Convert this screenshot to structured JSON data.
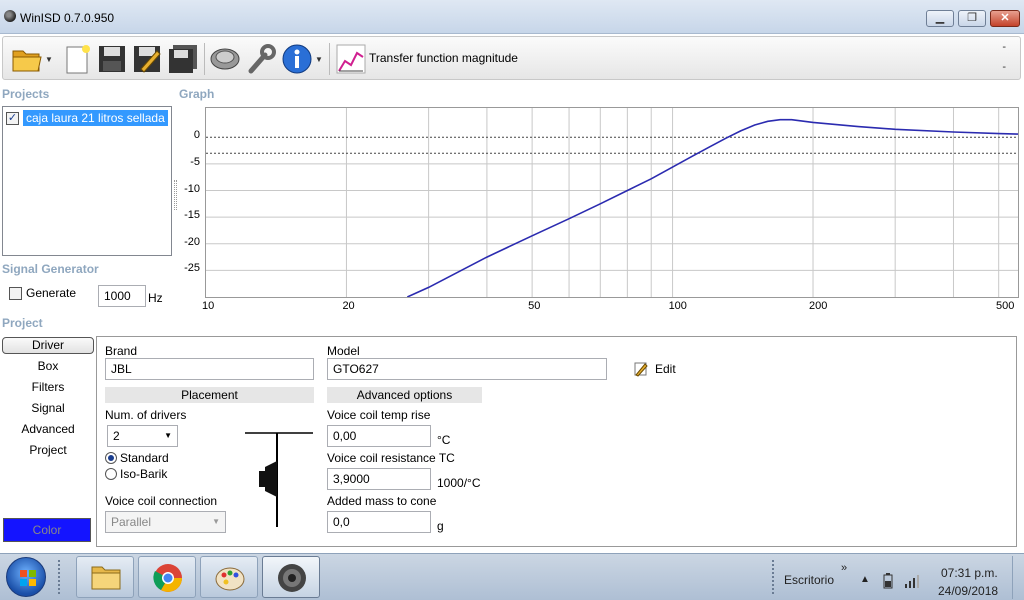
{
  "window": {
    "title": "WinISD 0.7.0.950"
  },
  "toolbar": {
    "graph_label": "Transfer function magnitude",
    "dash_top": "-",
    "dash_bottom": "-"
  },
  "sections": {
    "projects": "Projects",
    "graph": "Graph",
    "signal_generator": "Signal Generator",
    "project": "Project"
  },
  "projects": {
    "items": [
      {
        "label": "caja laura 21 litros sellada",
        "checked": true
      }
    ]
  },
  "graph": {
    "y_ticks": [
      "0",
      "-5",
      "-10",
      "-15",
      "-20",
      "-25"
    ],
    "x_ticks": [
      "10",
      "20",
      "50",
      "100",
      "200",
      "500"
    ]
  },
  "chart_data": {
    "type": "line",
    "title": "Transfer function magnitude",
    "x_scale": "log",
    "xlim": [
      10,
      550
    ],
    "ylim": [
      -30,
      5.5
    ],
    "grid": true,
    "reference_lines": [
      0,
      -3
    ],
    "series": [
      {
        "color": "#2b2bb0",
        "x": [
          27,
          30,
          40,
          50,
          60,
          70,
          80,
          90,
          100,
          110,
          120,
          130,
          140,
          150,
          160,
          170,
          180,
          200,
          250,
          300,
          400,
          500,
          550
        ],
        "y": [
          -30,
          -28.2,
          -22.5,
          -18.5,
          -15.3,
          -12.5,
          -10.0,
          -7.8,
          -5.6,
          -3.6,
          -1.8,
          -0.2,
          1.2,
          2.3,
          3.0,
          3.3,
          3.3,
          2.8,
          2.0,
          1.5,
          1.0,
          0.7,
          0.6
        ]
      }
    ]
  },
  "signal_generator": {
    "generate_label": "Generate",
    "frequency": "1000",
    "unit": "Hz"
  },
  "nav": {
    "items": [
      "Driver",
      "Box",
      "Filters",
      "Signal",
      "Advanced",
      "Project"
    ],
    "color_label": "Color",
    "color_value": "#1414ff"
  },
  "driver": {
    "brand_label": "Brand",
    "brand_value": "JBL",
    "model_label": "Model",
    "model_value": "GTO627",
    "edit_label": "Edit",
    "placement_header": "Placement",
    "num_drivers_label": "Num. of drivers",
    "num_drivers_value": "2",
    "standard_label": "Standard",
    "isobarik_label": "Iso-Barik",
    "vc_connection_label": "Voice coil connection",
    "vc_connection_value": "Parallel",
    "advanced_header": "Advanced options",
    "vc_temp_label": "Voice coil temp rise",
    "vc_temp_value": "0,00",
    "vc_temp_unit": "°C",
    "vc_res_label": "Voice coil resistance TC",
    "vc_res_value": "3,9000",
    "vc_res_unit": "1000/°C",
    "added_mass_label": "Added mass to cone",
    "added_mass_value": "0,0",
    "added_mass_unit": "g"
  },
  "taskbar": {
    "tray_label": "Escritorio",
    "time": "07:31 p.m.",
    "date": "24/09/2018"
  }
}
